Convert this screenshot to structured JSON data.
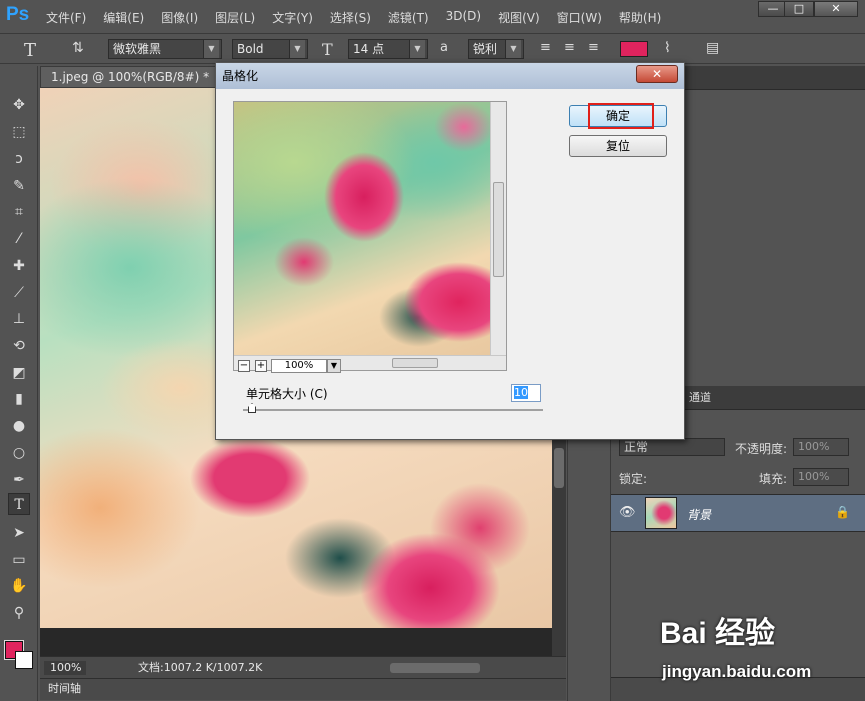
{
  "app": {
    "logo": "Ps",
    "menu": [
      "文件(F)",
      "编辑(E)",
      "图像(I)",
      "图层(L)",
      "文字(Y)",
      "选择(S)",
      "滤镜(T)",
      "3D(D)",
      "视图(V)",
      "窗口(W)",
      "帮助(H)"
    ],
    "window_controls": [
      "—",
      "□",
      "✕"
    ]
  },
  "options": {
    "font_family": "微软雅黑",
    "font_style": "Bold",
    "font_size": "14 点",
    "aa_label": "a",
    "aa_value": "锐利",
    "text_color": "#e0245e"
  },
  "document": {
    "tab_title": "1.jpeg @ 100%(RGB/8#) *",
    "zoom": "100%",
    "doc_info": "文档:1007.2 K/1007.2K",
    "timeline": "时间轴"
  },
  "tools": {
    "icons": [
      "move-icon",
      "marquee-icon",
      "lasso-icon",
      "quick-select-icon",
      "crop-icon",
      "eyedropper-icon",
      "healing-icon",
      "brush-icon",
      "stamp-icon",
      "history-brush-icon",
      "eraser-icon",
      "gradient-icon",
      "blur-icon",
      "dodge-icon",
      "pen-icon",
      "type-icon",
      "path-select-icon",
      "shape-icon",
      "hand-icon",
      "zoom-icon"
    ],
    "foreground": "#e0245e",
    "background": "#ffffff"
  },
  "layers": {
    "tab_fragment": "通道",
    "blend_mode": "正常",
    "opacity_label": "不透明度:",
    "opacity_value": "100%",
    "lock_label": "锁定:",
    "fill_label": "填充:",
    "fill_value": "100%",
    "layer_name": "背景"
  },
  "dialog": {
    "title": "晶格化",
    "close": "✕",
    "ok": "确定",
    "reset": "复位",
    "zoom_value": "100%",
    "zoom_minus": "−",
    "zoom_plus": "+",
    "cell_size_label": "单元格大小 (C)",
    "cell_size_value": "10"
  },
  "watermark": {
    "brand": "Bai 经验",
    "url": "jingyan.baidu.com"
  }
}
